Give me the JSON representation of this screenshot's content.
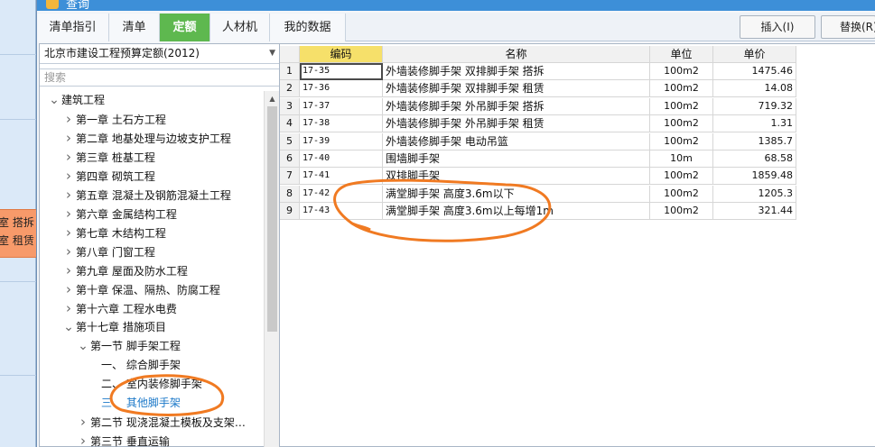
{
  "background": {
    "highlight_lines": [
      "室 搭拆",
      "室 租赁"
    ]
  },
  "dialog": {
    "title": "查询"
  },
  "tabs": [
    {
      "label": "清单指引",
      "active": false
    },
    {
      "label": "清单",
      "active": false
    },
    {
      "label": "定额",
      "active": true
    },
    {
      "label": "人材机",
      "active": false
    },
    {
      "label": "我的数据",
      "active": false
    }
  ],
  "toolbar": {
    "insert_label": "插入(I)",
    "replace_label": "替换(R)"
  },
  "library": {
    "selected": "北京市建设工程预算定额(2012)"
  },
  "search": {
    "placeholder": "搜索"
  },
  "tree": [
    {
      "label": "建筑工程",
      "level": 0,
      "expanded": true
    },
    {
      "label": "第一章 土石方工程",
      "level": 1,
      "expanded": false
    },
    {
      "label": "第二章 地基处理与边坡支护工程",
      "level": 1,
      "expanded": false
    },
    {
      "label": "第三章 桩基工程",
      "level": 1,
      "expanded": false
    },
    {
      "label": "第四章 砌筑工程",
      "level": 1,
      "expanded": false
    },
    {
      "label": "第五章 混凝土及钢筋混凝土工程",
      "level": 1,
      "expanded": false
    },
    {
      "label": "第六章 金属结构工程",
      "level": 1,
      "expanded": false
    },
    {
      "label": "第七章 木结构工程",
      "level": 1,
      "expanded": false
    },
    {
      "label": "第八章 门窗工程",
      "level": 1,
      "expanded": false
    },
    {
      "label": "第九章 屋面及防水工程",
      "level": 1,
      "expanded": false
    },
    {
      "label": "第十章 保温、隔热、防腐工程",
      "level": 1,
      "expanded": false
    },
    {
      "label": "第十六章 工程水电费",
      "level": 1,
      "expanded": false
    },
    {
      "label": "第十七章 措施项目",
      "level": 1,
      "expanded": true
    },
    {
      "label": "第一节 脚手架工程",
      "level": 2,
      "expanded": true
    },
    {
      "label": "一、 综合脚手架",
      "level": 3,
      "leaf": true
    },
    {
      "label": "二、 室内装修脚手架",
      "level": 3,
      "leaf": true
    },
    {
      "label": "三、 其他脚手架",
      "level": 3,
      "leaf": true,
      "selected": true
    },
    {
      "label": "第二节 现浇混凝土模板及支架…",
      "level": 2,
      "expanded": false
    },
    {
      "label": "第三节 垂直运输",
      "level": 2,
      "expanded": false
    }
  ],
  "grid": {
    "columns": [
      "编码",
      "名称",
      "单位",
      "单价"
    ],
    "rows": [
      {
        "no": "1",
        "code": "17-35",
        "name": "外墙装修脚手架 双排脚手架 搭拆",
        "unit": "100m2",
        "price": "1475.46"
      },
      {
        "no": "2",
        "code": "17-36",
        "name": "外墙装修脚手架 双排脚手架 租赁",
        "unit": "100m2",
        "price": "14.08"
      },
      {
        "no": "3",
        "code": "17-37",
        "name": "外墙装修脚手架 外吊脚手架 搭拆",
        "unit": "100m2",
        "price": "719.32"
      },
      {
        "no": "4",
        "code": "17-38",
        "name": "外墙装修脚手架 外吊脚手架 租赁",
        "unit": "100m2",
        "price": "1.31"
      },
      {
        "no": "5",
        "code": "17-39",
        "name": "外墙装修脚手架 电动吊篮",
        "unit": "100m2",
        "price": "1385.7"
      },
      {
        "no": "6",
        "code": "17-40",
        "name": "围墙脚手架",
        "unit": "10m",
        "price": "68.58"
      },
      {
        "no": "7",
        "code": "17-41",
        "name": "双排脚手架",
        "unit": "100m2",
        "price": "1859.48"
      },
      {
        "no": "8",
        "code": "17-42",
        "name": "满堂脚手架 高度3.6m以下",
        "unit": "100m2",
        "price": "1205.3"
      },
      {
        "no": "9",
        "code": "17-43",
        "name": "满堂脚手架 高度3.6m以上每增1m",
        "unit": "100m2",
        "price": "321.44"
      }
    ]
  },
  "colors": {
    "active_tab": "#5eb84f",
    "code_header": "#f6e06a",
    "annotation": "#f07a22",
    "selected_tree": "#1b78c8"
  }
}
